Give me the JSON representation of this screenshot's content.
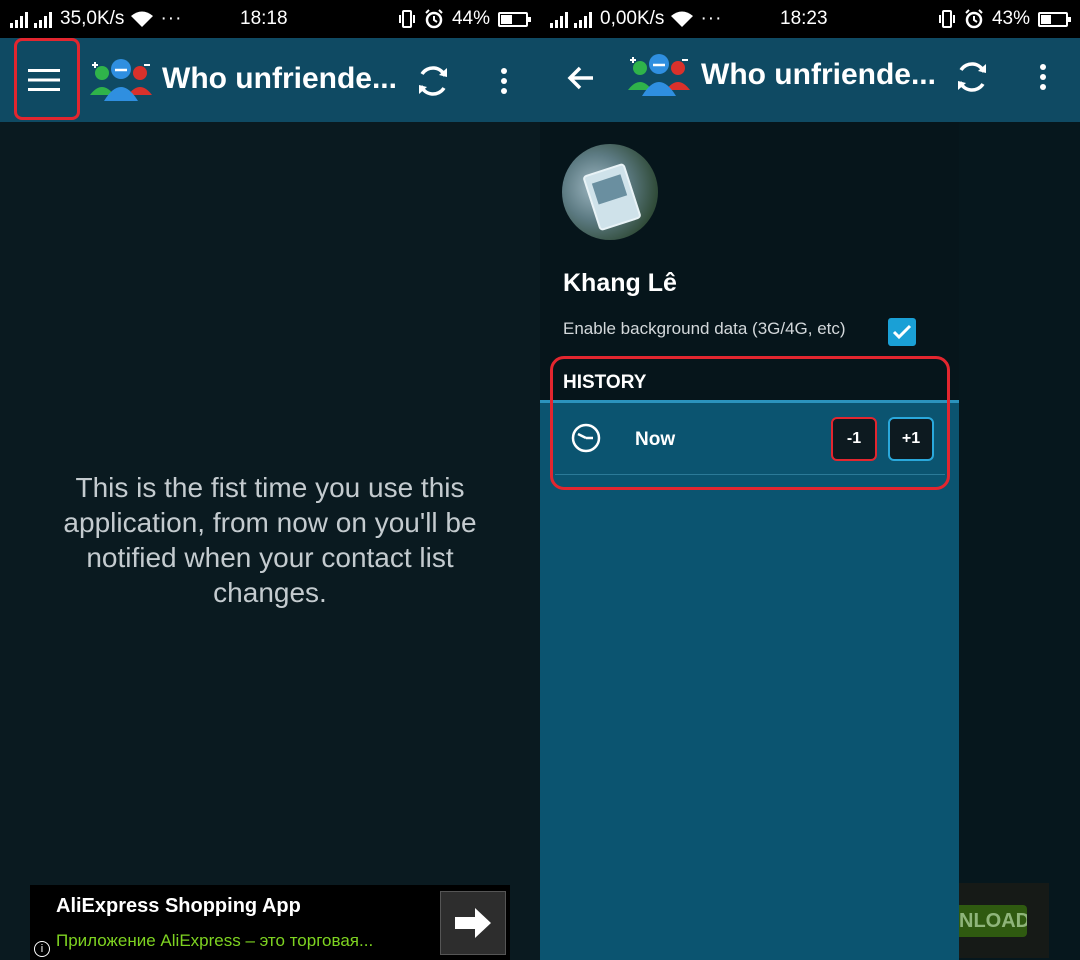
{
  "left": {
    "status": {
      "speed": "35,0K/s",
      "time": "18:18",
      "battery": "44%",
      "battery_level": 0.44
    },
    "appbar": {
      "title": "Who unfriende..."
    },
    "empty_message": "This is the fist time you use this application, from now on you'll be notified when your contact list changes.",
    "ad": {
      "title": "AliExpress Shopping App",
      "subtitle": "Приложение AliExpress – это торговая...",
      "info": "i"
    }
  },
  "right": {
    "status": {
      "speed": "0,00K/s",
      "time": "18:23",
      "battery": "43%",
      "battery_level": 0.43
    },
    "appbar": {
      "title": "Who unfriende..."
    },
    "drawer": {
      "user_name": "Khang Lê",
      "background_data_label": "Enable background data (3G/4G, etc)",
      "background_data_checked": true,
      "history_label": "HISTORY",
      "history_items": [
        {
          "label": "Now",
          "minus": "-1",
          "plus": "+1"
        }
      ]
    },
    "download_fragment": "NLOAD"
  },
  "colors": {
    "appbar": "#0f4a63",
    "drawer": "#0b5470",
    "highlight": "#e3262f",
    "accent": "#1aa0d6"
  }
}
